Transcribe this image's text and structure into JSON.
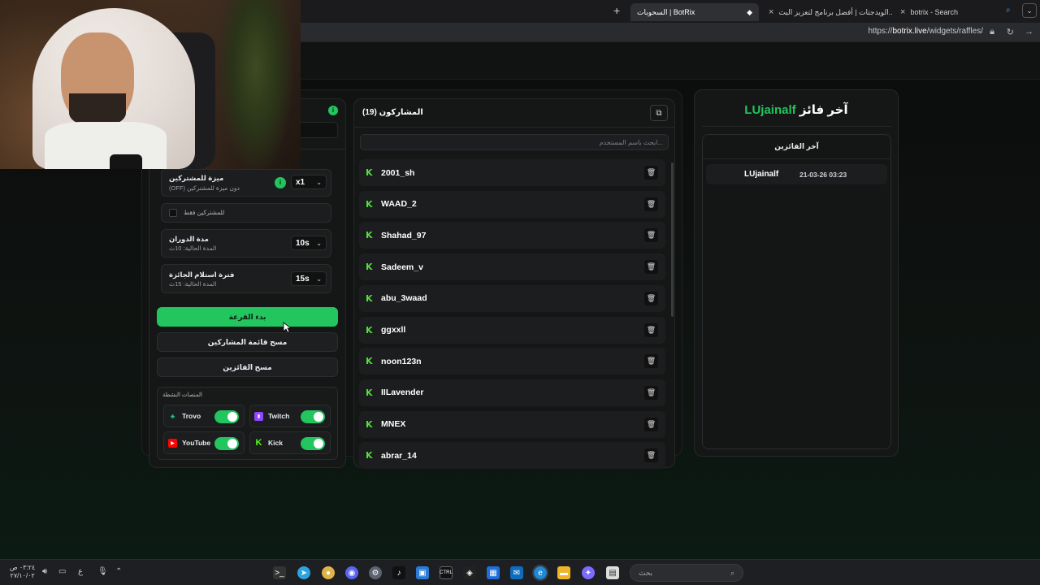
{
  "browser": {
    "tabs": [
      {
        "label": "botrix - Search"
      },
      {
        "label": "الويدجتات | أفضل برنامج لتعزيز البث..."
      },
      {
        "label": "السحوبات | BotRix"
      }
    ],
    "new_tab": "+",
    "url_prefix": "https://",
    "url_domain": "botrix.live",
    "url_path": "/widgets/raffles/"
  },
  "settings": {
    "info_badge": "i",
    "subscriber_perk": {
      "title": "ميزة للمشتركين",
      "subtitle": "دون ميزة للمشتركين (OFF)",
      "badge": "i",
      "multiplier": "x1"
    },
    "subscribers_only": {
      "label": "للمشتركين فقط"
    },
    "spin_duration": {
      "title": "مدة الدوران",
      "subtitle": "المدة الحالية: 10ث",
      "value": "10s"
    },
    "claim_period": {
      "title": "فترة استلام الجائزة",
      "subtitle": "المدة الحالية: 15ث",
      "value": "15s"
    },
    "start_button": "بدء القرعة",
    "clear_participants_button": "مسح قائمة المشاركين",
    "clear_winners_button": "مسح الفائزين",
    "platforms_title": "المنصات النشطة",
    "platforms": [
      {
        "name": "Trovo",
        "enabled": true,
        "color": "#1fc28f"
      },
      {
        "name": "Twitch",
        "enabled": true,
        "color": "#9146ff"
      },
      {
        "name": "YouTube",
        "enabled": true,
        "color": "#ff0000"
      },
      {
        "name": "Kick",
        "enabled": true,
        "color": "#53fc18"
      }
    ]
  },
  "participants": {
    "title": "المشاركون (19)",
    "search_placeholder": "...ابحث باسم المستخدم",
    "items": [
      {
        "name": "2001_sh"
      },
      {
        "name": "WAAD_2"
      },
      {
        "name": "Shahad_97"
      },
      {
        "name": "Sadeem_v"
      },
      {
        "name": "abu_3waad"
      },
      {
        "name": "ggxxll"
      },
      {
        "name": "noon123n"
      },
      {
        "name": "IILavender"
      },
      {
        "name": "MNEX"
      },
      {
        "name": "abrar_14"
      }
    ]
  },
  "winner": {
    "title_prefix": "آخر فائز",
    "name": "LUjainalf",
    "list_title": "آخر الفائزين",
    "list": [
      {
        "name": "LUjainalf",
        "date": "21-03-26 03:23"
      }
    ]
  },
  "taskbar": {
    "search_placeholder": "بحث",
    "time": "٠٣:٢٤ ص",
    "date": "٢٧/١٠/٠٢",
    "lang": "ع"
  },
  "colors": {
    "accent": "#22c55e",
    "kick": "#52e03a"
  }
}
